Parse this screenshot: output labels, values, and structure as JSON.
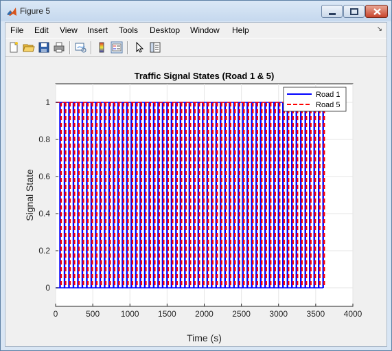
{
  "window": {
    "title": "Figure 5"
  },
  "menu": {
    "items": [
      {
        "label": "File"
      },
      {
        "label": "Edit"
      },
      {
        "label": "View"
      },
      {
        "label": "Insert"
      },
      {
        "label": "Tools"
      },
      {
        "label": "Desktop"
      },
      {
        "label": "Window"
      },
      {
        "label": "Help"
      }
    ]
  },
  "toolbar": {
    "icons": [
      "new-figure-icon",
      "open-file-icon",
      "save-icon",
      "print-icon",
      "link-plot-icon",
      "colorbar-icon",
      "legend-icon",
      "pointer-icon",
      "property-inspector-icon"
    ]
  },
  "colors": {
    "road1": "#0000ff",
    "road5": "#ff0000"
  },
  "chart_data": {
    "type": "line",
    "title": "Traffic Signal States (Road 1 & 5)",
    "xlabel": "Time (s)",
    "ylabel": "Signal State",
    "xlim": [
      0,
      4000
    ],
    "ylim": [
      -0.1,
      1.1
    ],
    "xticks": [
      "0",
      "500",
      "1000",
      "1500",
      "2000",
      "2500",
      "3000",
      "3500",
      "4000"
    ],
    "yticks": [
      "0",
      "0.2",
      "0.4",
      "0.6",
      "0.8",
      "1"
    ],
    "grid": true,
    "legend_position": "top-right",
    "x_range_of_data": [
      0,
      3600
    ],
    "approx_switch_period_s": 60,
    "series": [
      {
        "name": "Road 1",
        "style": "solid",
        "values": [
          0,
          1
        ]
      },
      {
        "name": "Road 5",
        "style": "dashed",
        "values": [
          0,
          1
        ]
      }
    ]
  }
}
